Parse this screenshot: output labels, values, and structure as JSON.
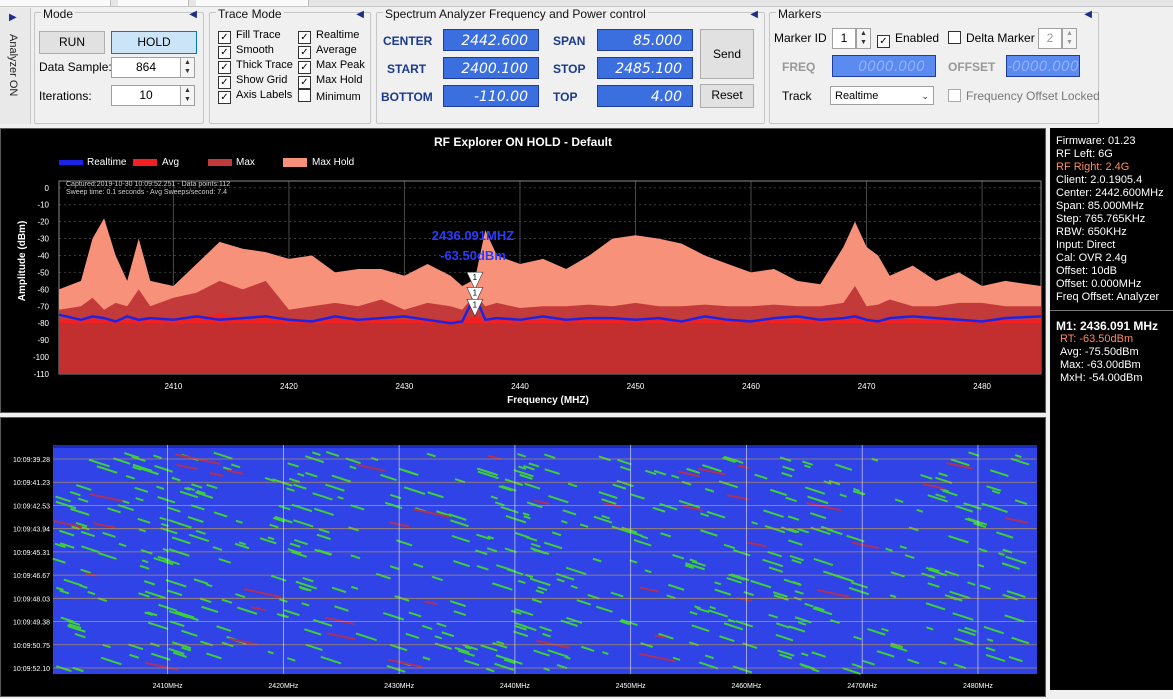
{
  "left_tab": {
    "label": "Analyzer ON"
  },
  "mode": {
    "title": "Mode",
    "run_label": "RUN",
    "hold_label": "HOLD",
    "data_sample_label": "Data Sample:",
    "data_sample_value": "864",
    "iterations_label": "Iterations:",
    "iterations_value": "10"
  },
  "trace_mode": {
    "title": "Trace Mode",
    "options": [
      {
        "label": "Fill Trace",
        "checked": true
      },
      {
        "label": "Smooth",
        "checked": true
      },
      {
        "label": "Thick Trace",
        "checked": true
      },
      {
        "label": "Show Grid",
        "checked": true
      },
      {
        "label": "Axis Labels",
        "checked": true
      },
      {
        "label": "Realtime",
        "checked": true
      },
      {
        "label": "Average",
        "checked": true
      },
      {
        "label": "Max Peak",
        "checked": true
      },
      {
        "label": "Max Hold",
        "checked": true
      },
      {
        "label": "Minimum",
        "checked": false
      }
    ]
  },
  "freq_control": {
    "title": "Spectrum Analyzer Frequency and Power control",
    "center_label": "CENTER",
    "center_value": "2442.600",
    "span_label": "SPAN",
    "span_value": "85.000",
    "start_label": "START",
    "start_value": "2400.100",
    "stop_label": "STOP",
    "stop_value": "2485.100",
    "bottom_label": "BOTTOM",
    "bottom_value": "-110.00",
    "top_label": "TOP",
    "top_value": "4.00",
    "send_label": "Send",
    "reset_label": "Reset"
  },
  "markers": {
    "title": "Markers",
    "marker_id_label": "Marker ID",
    "marker_id_value": "1",
    "enabled_label": "Enabled",
    "enabled_checked": true,
    "delta_label": "Delta Marker",
    "delta_checked": false,
    "delta_value": "2",
    "freq_label": "FREQ",
    "freq_value": "0000.000",
    "offset_label": "OFFSET",
    "offset_value": "-0000.000",
    "track_label": "Track",
    "track_value": "Realtime",
    "locked_label": "Frequency Offset Locked",
    "locked_checked": false
  },
  "spectrum": {
    "title": "RF Explorer ON HOLD - Default",
    "legend": [
      "Realtime",
      "Avg",
      "Max",
      "Max Hold"
    ],
    "captured_line1": "Captured:2019-10-30 10:09:52.251 - Data points:112",
    "captured_line2": "Sweep time: 0.1 seconds - Avg Sweeps/second: 7.4",
    "marker_freq": "2436.091MHZ",
    "marker_amp": "-63.50dBm",
    "marker_ids": [
      "1",
      "1",
      "1"
    ],
    "ylabel": "Amplitude (dBm)",
    "xlabel": "Frequency (MHZ)",
    "colors": {
      "realtime": "#1b24e6",
      "avg": "#f22020",
      "max": "#c33a3a",
      "maxhold": "#f7917a"
    }
  },
  "chart_data": {
    "type": "area",
    "title": "RF Explorer ON HOLD - Default",
    "xlabel": "Frequency (MHZ)",
    "ylabel": "Amplitude (dBm)",
    "xlim": [
      2400.1,
      2485.1
    ],
    "ylim": [
      -110,
      4
    ],
    "x_ticks": [
      2410,
      2420,
      2430,
      2440,
      2450,
      2460,
      2470,
      2480
    ],
    "y_ticks": [
      0,
      -10,
      -20,
      -30,
      -40,
      -50,
      -60,
      -70,
      -80,
      -90,
      -100,
      -110
    ],
    "grid": true,
    "legend_position": "top-left",
    "x": [
      2400.1,
      2402,
      2403,
      2404,
      2405,
      2406,
      2407,
      2408,
      2410,
      2412,
      2414,
      2416,
      2418,
      2420,
      2422,
      2424,
      2426,
      2428,
      2430,
      2432,
      2434,
      2435,
      2436.1,
      2437,
      2438,
      2440,
      2442,
      2444,
      2446,
      2448,
      2450,
      2452,
      2454,
      2456,
      2458,
      2460,
      2462,
      2464,
      2466,
      2468,
      2469,
      2470,
      2471,
      2472,
      2474,
      2476,
      2478,
      2480,
      2482,
      2485.1
    ],
    "series": [
      {
        "name": "Max Hold",
        "values": [
          -60,
          -55,
          -30,
          -18,
          -40,
          -55,
          -30,
          -55,
          -58,
          -45,
          -32,
          -36,
          -38,
          -42,
          -40,
          -50,
          -48,
          -48,
          -52,
          -45,
          -52,
          -58,
          -54,
          -25,
          -40,
          -45,
          -42,
          -48,
          -40,
          -30,
          -28,
          -30,
          -33,
          -40,
          -45,
          -50,
          -48,
          -55,
          -57,
          -35,
          -20,
          -35,
          -40,
          -52,
          -46,
          -55,
          -50,
          -58,
          -55,
          -58
        ]
      },
      {
        "name": "Max",
        "values": [
          -72,
          -70,
          -65,
          -72,
          -68,
          -70,
          -60,
          -70,
          -65,
          -62,
          -55,
          -60,
          -55,
          -72,
          -70,
          -68,
          -70,
          -66,
          -72,
          -68,
          -70,
          -72,
          -63,
          -70,
          -68,
          -71,
          -70,
          -70,
          -69,
          -70,
          -68,
          -70,
          -70,
          -69,
          -70,
          -70,
          -69,
          -70,
          -70,
          -68,
          -58,
          -70,
          -69,
          -66,
          -70,
          -70,
          -68,
          -68,
          -70,
          -70
        ]
      },
      {
        "name": "Avg",
        "values": [
          -78,
          -78,
          -77,
          -78,
          -78,
          -78,
          -77,
          -78,
          -77,
          -77,
          -74,
          -77,
          -75,
          -78,
          -78,
          -77,
          -78,
          -77,
          -78,
          -78,
          -78,
          -78,
          -75.5,
          -78,
          -77,
          -78,
          -78,
          -78,
          -78,
          -78,
          -78,
          -78,
          -78,
          -78,
          -78,
          -78,
          -78,
          -78,
          -78,
          -78,
          -74,
          -78,
          -78,
          -77,
          -78,
          -78,
          -78,
          -78,
          -78,
          -78
        ]
      },
      {
        "name": "Realtime",
        "values": [
          -75,
          -78,
          -76,
          -77,
          -79,
          -76,
          -78,
          -77,
          -78,
          -76,
          -78,
          -77,
          -76,
          -78,
          -79,
          -76,
          -78,
          -77,
          -76,
          -78,
          -80,
          -79,
          -63.5,
          -78,
          -77,
          -78,
          -76,
          -78,
          -77,
          -77,
          -78,
          -77,
          -79,
          -76,
          -78,
          -79,
          -77,
          -76,
          -78,
          -77,
          -76,
          -78,
          -79,
          -77,
          -76,
          -77,
          -78,
          -79,
          -77,
          -76
        ]
      }
    ]
  },
  "waterfall": {
    "times": [
      "10:09:39.28",
      "10:09:41.23",
      "10:09:42.53",
      "10:09:43.94",
      "10:09:45.31",
      "10:09:46.67",
      "10:09:48.03",
      "10:09:49.38",
      "10:09:50.75",
      "10:09:52.10"
    ],
    "freq_labels": [
      "2410MHz",
      "2420MHz",
      "2430MHz",
      "2440MHz",
      "2450MHz",
      "2460MHz",
      "2470MHz",
      "2480MHz"
    ],
    "colors": {
      "background": "#2f43e6",
      "signal": "#3ecf3a",
      "peak": "#b0305a"
    }
  },
  "info": {
    "lines": [
      "Firmware: 01.23",
      "RF Left: 6G",
      "RF Right: 2.4G",
      "Client: 2.0.1905.4",
      "Center: 2442.600MHz",
      "Span: 85.000MHz",
      "Step: 765.765KHz",
      "RBW: 650KHz",
      "Input: Direct",
      "Cal: OVR 2.4g",
      "Offset: 10dB",
      "Offset: 0.000MHz",
      "Freq Offset: Analyzer"
    ],
    "marker_title": "M1: 2436.091 MHz",
    "marker_rt": "RT: -63.50dBm",
    "marker_avg": "Avg: -75.50dBm",
    "marker_max": "Max: -63.00dBm",
    "marker_mxh": "MxH: -54.00dBm",
    "highlight_color": "#ff8a5c"
  }
}
